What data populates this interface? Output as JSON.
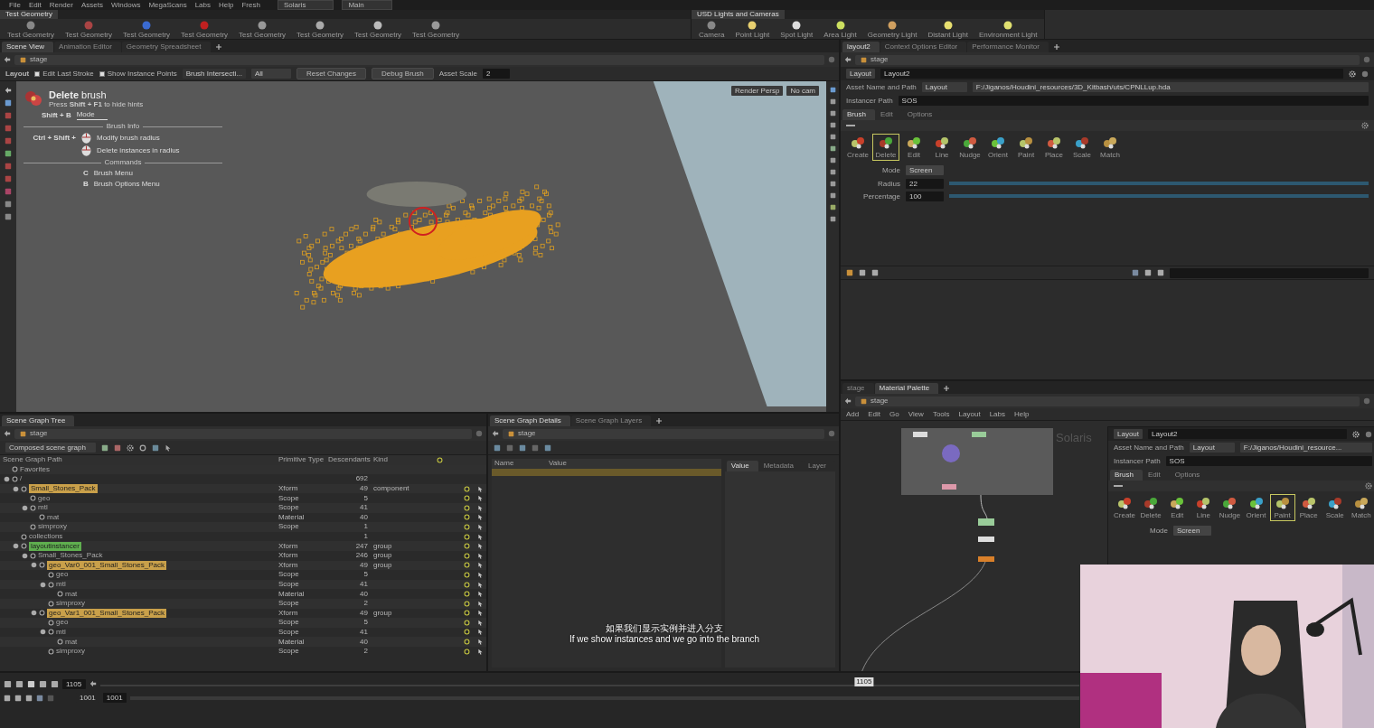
{
  "menu_bar": {
    "items": [
      "File",
      "Edit",
      "Render",
      "Assets",
      "Windows",
      "MegaScans",
      "Labs",
      "Help",
      "Fresh"
    ],
    "desktop": "Solaris",
    "workspace": "Main"
  },
  "shelves": [
    {
      "tabs": [
        {
          "label": "Test Geometry",
          "selected": true
        }
      ],
      "tools": [
        "Test Geometry",
        "Test Geometry",
        "Test Geometry",
        "Test Geometry",
        "Test Geometry",
        "Test Geometry",
        "Test Geometry",
        "Test Geometry"
      ]
    },
    {
      "tabs": [
        {
          "label": "USD Lights and Cameras",
          "selected": true
        }
      ],
      "tools": [
        "Camera",
        "Point Light",
        "Spot Light",
        "Area Light",
        "Geometry Light",
        "Distant Light",
        "Environment Light"
      ]
    }
  ],
  "scene_view": {
    "tabs": [
      {
        "label": "Scene View",
        "selected": true
      },
      {
        "label": "Animation Editor",
        "selected": false
      },
      {
        "label": "Geometry Spreadsheet",
        "selected": false
      }
    ],
    "path": "stage",
    "toolbar": {
      "state": "Layout",
      "checks": [
        {
          "label": "Edit Last Stroke",
          "checked": true
        },
        {
          "label": "Show Instance Points",
          "checked": true
        }
      ],
      "intersection": "Brush Intersecti...",
      "filter": "All",
      "buttons": [
        "Reset Changes",
        "Debug Brush"
      ],
      "scale_label": "Asset Scale",
      "scale_value": "2"
    },
    "camera_menus": [
      "Render Persp",
      "No cam"
    ],
    "hints": {
      "title": "**Delete** brush",
      "subtitle": "Press **Shift + F1** to hide hints",
      "mode_key": "Shift + B",
      "mode_label": "Mode",
      "sections": [
        {
          "heading": "Brush Info",
          "rows": [
            {
              "kind": "mouse",
              "keys": "Ctrl + Shift +",
              "action": "Modify brush radius"
            },
            {
              "kind": "mouse",
              "action": "Delete instances in radius"
            }
          ]
        },
        {
          "heading": "Commands",
          "rows": [
            {
              "kind": "key",
              "keys": "C",
              "action": "Brush Menu"
            },
            {
              "kind": "key",
              "keys": "B",
              "action": "Brush Options Menu"
            }
          ]
        }
      ]
    }
  },
  "parameters": {
    "tabs": [
      {
        "label": "layout2",
        "selected": true
      },
      {
        "label": "Context Options Editor",
        "selected": false
      },
      {
        "label": "Performance Monitor",
        "selected": false
      }
    ],
    "path": "stage",
    "node_type": "Layout",
    "node_name": "Layout2",
    "asset_label": "Asset Name and Path",
    "asset_source": "Layout",
    "asset_path": "F:/Jiganos/Houdini_resources/3D_Kitbash/uts/CPNLLup.hda",
    "instancer_label": "Instancer Path",
    "instancer_value": "SOS",
    "subtabs": [
      {
        "label": "Brush",
        "selected": true
      },
      {
        "label": "Edit",
        "selected": false
      },
      {
        "label": "Options",
        "selected": false
      }
    ],
    "brushes": [
      {
        "label": "Create",
        "selected": false
      },
      {
        "label": "Delete",
        "selected": true
      },
      {
        "label": "Edit",
        "selected": false
      },
      {
        "label": "Line",
        "selected": false
      },
      {
        "label": "Nudge",
        "selected": false
      },
      {
        "label": "Orient",
        "selected": false
      },
      {
        "label": "Paint",
        "selected": false
      },
      {
        "label": "Place",
        "selected": false
      },
      {
        "label": "Scale",
        "selected": false
      },
      {
        "label": "Match",
        "selected": false
      }
    ],
    "mode_label": "Mode",
    "mode_value": "Screen",
    "sliders": [
      {
        "label": "Radius",
        "value": "22",
        "level": 1
      },
      {
        "label": "Percentage",
        "value": "100",
        "level": 1
      }
    ]
  },
  "scene_tree": {
    "tab": "Scene Graph Tree",
    "path": "stage",
    "source": "Composed scene graph",
    "columns": [
      "Scene Graph Path",
      "Primitive Type",
      "Descendants",
      "Kind"
    ],
    "rows": [
      {
        "name": "Favorites"
      },
      {
        "name": "/",
        "descendants": "692",
        "children": [
          {
            "name": "Small_Stones_Pack",
            "color": "#c9a04a",
            "type": "Xform",
            "descendants": "49",
            "kind": "component",
            "children": [
              {
                "name": "geo",
                "type": "Scope",
                "descendants": "5"
              },
              {
                "name": "mtl",
                "type": "Scope",
                "descendants": "41",
                "children": [
                  {
                    "name": "mat",
                    "type": "Material",
                    "descendants": "40"
                  }
                ]
              },
              {
                "name": "simproxy",
                "type": "Scope",
                "descendants": "1"
              }
            ]
          },
          {
            "name": "collections",
            "descendants": "1"
          },
          {
            "name": "layoutinstancer",
            "color": "#5fae4f",
            "type": "Xform",
            "descendants": "247",
            "kind": "group",
            "children": [
              {
                "name": "Small_Stones_Pack",
                "type": "Xform",
                "descendants": "246",
                "kind": "group",
                "children": [
                  {
                    "name": "geo_Var0_001_Small_Stones_Pack",
                    "color": "#c9a04a",
                    "type": "Xform",
                    "descendants": "49",
                    "kind": "group",
                    "children": [
                      {
                        "name": "geo",
                        "type": "Scope",
                        "descendants": "5"
                      },
                      {
                        "name": "mtl",
                        "type": "Scope",
                        "descendants": "41",
                        "children": [
                          {
                            "name": "mat",
                            "type": "Material",
                            "descendants": "40"
                          }
                        ]
                      },
                      {
                        "name": "simproxy",
                        "type": "Scope",
                        "descendants": "2"
                      }
                    ]
                  },
                  {
                    "name": "geo_Var1_001_Small_Stones_Pack",
                    "color": "#c9a04a",
                    "type": "Xform",
                    "descendants": "49",
                    "kind": "group",
                    "children": [
                      {
                        "name": "geo",
                        "type": "Scope",
                        "descendants": "5"
                      },
                      {
                        "name": "mtl",
                        "type": "Scope",
                        "descendants": "41",
                        "children": [
                          {
                            "name": "mat",
                            "type": "Material",
                            "descendants": "40"
                          }
                        ]
                      },
                      {
                        "name": "simproxy",
                        "type": "Scope",
                        "descendants": "2"
                      }
                    ]
                  }
                ]
              }
            ]
          }
        ]
      }
    ]
  },
  "details": {
    "tabs": [
      {
        "label": "Scene Graph Details",
        "selected": true
      },
      {
        "label": "Scene Graph Layers",
        "selected": false
      }
    ],
    "path": "stage",
    "columns": [
      "Name",
      "Value"
    ],
    "side_tabs": [
      {
        "label": "Value",
        "selected": true
      },
      {
        "label": "Metadata",
        "selected": false
      },
      {
        "label": "Layer",
        "selected": false
      }
    ]
  },
  "network": {
    "tabs": [
      {
        "label": "stage",
        "selected": false
      },
      {
        "label": "Material Palette",
        "selected": true
      }
    ],
    "path": "stage",
    "menu": [
      "Add",
      "Edit",
      "Go",
      "View",
      "Tools",
      "Layout",
      "Labs",
      "Help"
    ],
    "context": "Solaris",
    "panel": {
      "node_type": "Layout",
      "node_name": "Layout2",
      "asset_label": "Asset Name and Path",
      "asset_source": "Layout",
      "asset_path": "F:/Jiganos/Houdini_resource...",
      "instancer_label": "Instancer Path",
      "instancer_value": "SOS",
      "subtabs": [
        {
          "label": "Brush",
          "selected": true
        },
        {
          "label": "Edit",
          "selected": false
        },
        {
          "label": "Options",
          "selected": false
        }
      ],
      "brushes": [
        {
          "label": "Create",
          "selected": false
        },
        {
          "label": "Delete",
          "selected": false
        },
        {
          "label": "Edit",
          "selected": false
        },
        {
          "label": "Line",
          "selected": false
        },
        {
          "label": "Nudge",
          "selected": false
        },
        {
          "label": "Orient",
          "selected": false
        },
        {
          "label": "Paint",
          "selected": true
        },
        {
          "label": "Place",
          "selected": false
        },
        {
          "label": "Scale",
          "selected": false
        },
        {
          "label": "Match",
          "selected": false
        }
      ],
      "mode_label": "Mode",
      "mode_value": "Screen"
    }
  },
  "timeline": {
    "frame": "1105",
    "start": "1001",
    "end": "1001",
    "marker": "1105",
    "level": 0.78
  },
  "subtitles": [
    "如果我们显示实例并进入分支",
    "If we show instances and we go into the branch"
  ],
  "webcam": {
    "kind": "picture"
  }
}
